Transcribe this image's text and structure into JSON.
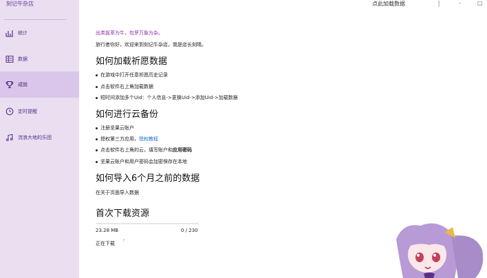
{
  "app": {
    "title": "刻记牛杂店"
  },
  "titlebar": {
    "action": "点此加载数据",
    "controls": [
      "⸽",
      "-",
      "□"
    ]
  },
  "sidebar": {
    "items": [
      {
        "label": "统计",
        "icon": "chart-icon",
        "active": false
      },
      {
        "label": "数据",
        "icon": "table-icon",
        "active": false
      },
      {
        "label": "成就",
        "icon": "trophy-icon",
        "active": true
      },
      {
        "label": "定时提醒",
        "icon": "clock-icon",
        "active": false
      },
      {
        "label": "流浪大地的乐团",
        "icon": "music-icon",
        "active": false
      }
    ]
  },
  "main": {
    "greeting": "出类拔萃为牛，包罗万象为杂。",
    "intro": "旅行者你好，欢迎来到刻记牛杂店，我是店长刻晴。",
    "section1": {
      "title": "如何加载祈愿数据",
      "items": [
        "在游戏中打开任意祈愿历史记录",
        "点击软件右上角加载数据",
        "短时间添加多个Uid：个人信息->更换Uid->添加Uid->加载数据"
      ]
    },
    "section2": {
      "title": "如何进行云备份",
      "item1": "注册坚果云账户",
      "item2_prefix": "授权第三方应用，",
      "item2_link": "授权教程",
      "item3_prefix": "点击软件右上角的云，填写账户和",
      "item3_bold": "应用密码",
      "item4": "坚果云账户和用户密码会加密保存在本地"
    },
    "section3": {
      "title": "如何导入6个月之前的数据",
      "text": "在关于页面导入数据"
    },
    "section4": {
      "title": "首次下载资源",
      "size": "23.28 MB",
      "count": "0 / 230",
      "status": "正在下载",
      "progress": 0
    }
  }
}
